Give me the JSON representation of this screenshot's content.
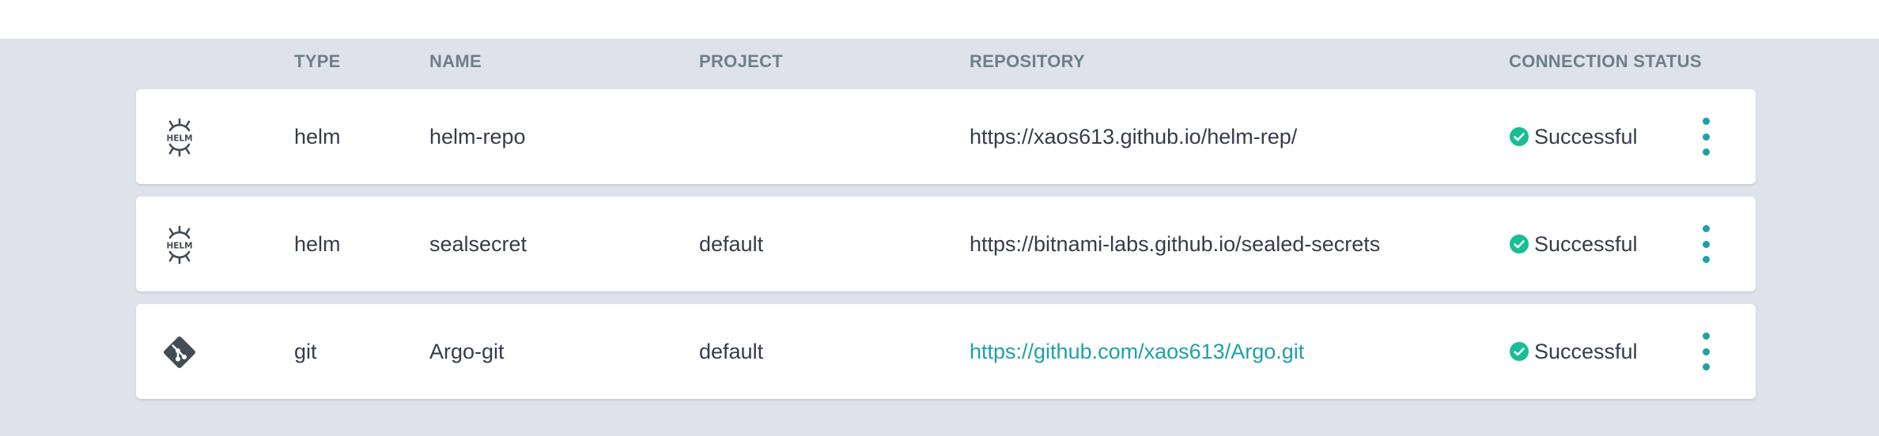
{
  "colors": {
    "background": "#dee3eb",
    "header_text": "#6d7f8b",
    "row_text": "#363c4a",
    "link": "#1fa0a8",
    "success": "#18be94",
    "icon": "#444c55"
  },
  "table": {
    "headers": {
      "type": "TYPE",
      "name": "NAME",
      "project": "PROJECT",
      "repository": "REPOSITORY",
      "connection_status": "CONNECTION STATUS"
    },
    "rows": [
      {
        "icon": "helm-icon",
        "type": "helm",
        "name": "helm-repo",
        "project": "",
        "repository": "https://xaos613.github.io/helm-rep/",
        "status": "Successful",
        "status_icon": "check-circle-icon",
        "menu_icon": "more-vertical-icon"
      },
      {
        "icon": "helm-icon",
        "type": "helm",
        "name": "sealsecret",
        "project": "default",
        "repository": "https://bitnami-labs.github.io/sealed-secrets",
        "status": "Successful",
        "status_icon": "check-circle-icon",
        "menu_icon": "more-vertical-icon"
      },
      {
        "icon": "git-icon",
        "type": "git",
        "name": "Argo-git",
        "project": "default",
        "repository": "https://github.com/xaos613/Argo.git",
        "repository_is_link": true,
        "status": "Successful",
        "status_icon": "check-circle-icon",
        "menu_icon": "more-vertical-icon"
      }
    ]
  }
}
